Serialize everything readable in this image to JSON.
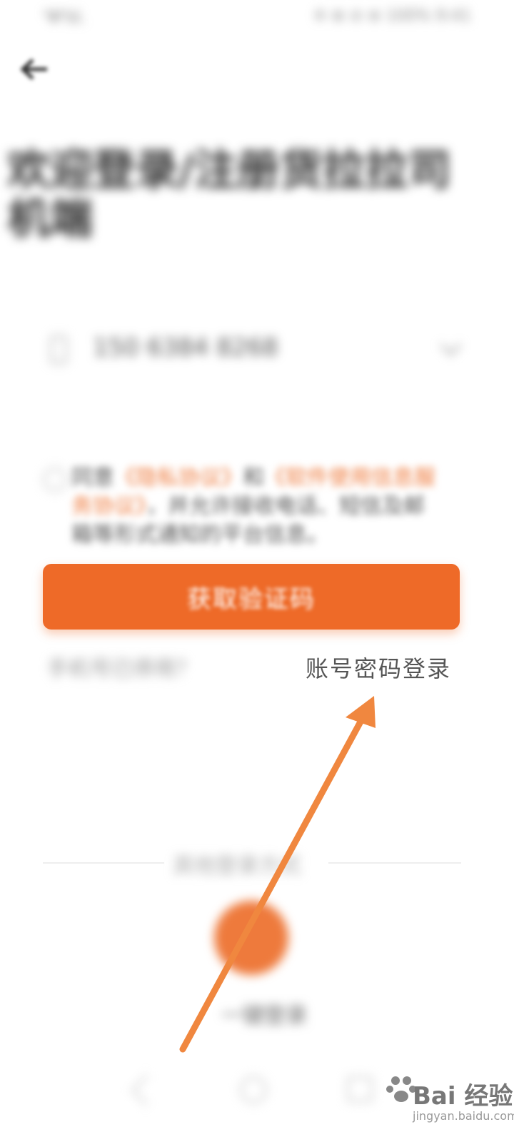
{
  "status": {
    "left": "'Ψ'lıl.",
    "right": "※ ⊗ ⊘ ⊛ 100% 9:41"
  },
  "title": "欢迎登录/注册货拉拉司机端",
  "phone": {
    "value": "150 6384 8268"
  },
  "agreement": {
    "prefix": "同意",
    "link1": "《隐私协议》",
    "mid": "和",
    "link2": "《软件使用信息服务协议》",
    "suffix": "，并允许接收电话、短信及邮箱等形式通知的平台信息。"
  },
  "buttons": {
    "get_code": "获取验证码",
    "phone_unavailable": "手机号已停用？",
    "password_login": "账号密码登录",
    "other_methods": "其他登录方式",
    "one_click_login": "一键登录"
  },
  "watermark": {
    "text": "Bai 经验",
    "sub": "jingyan.baidu.com"
  },
  "colors": {
    "accent": "#ee6a28",
    "arrow": "#f0873f"
  }
}
